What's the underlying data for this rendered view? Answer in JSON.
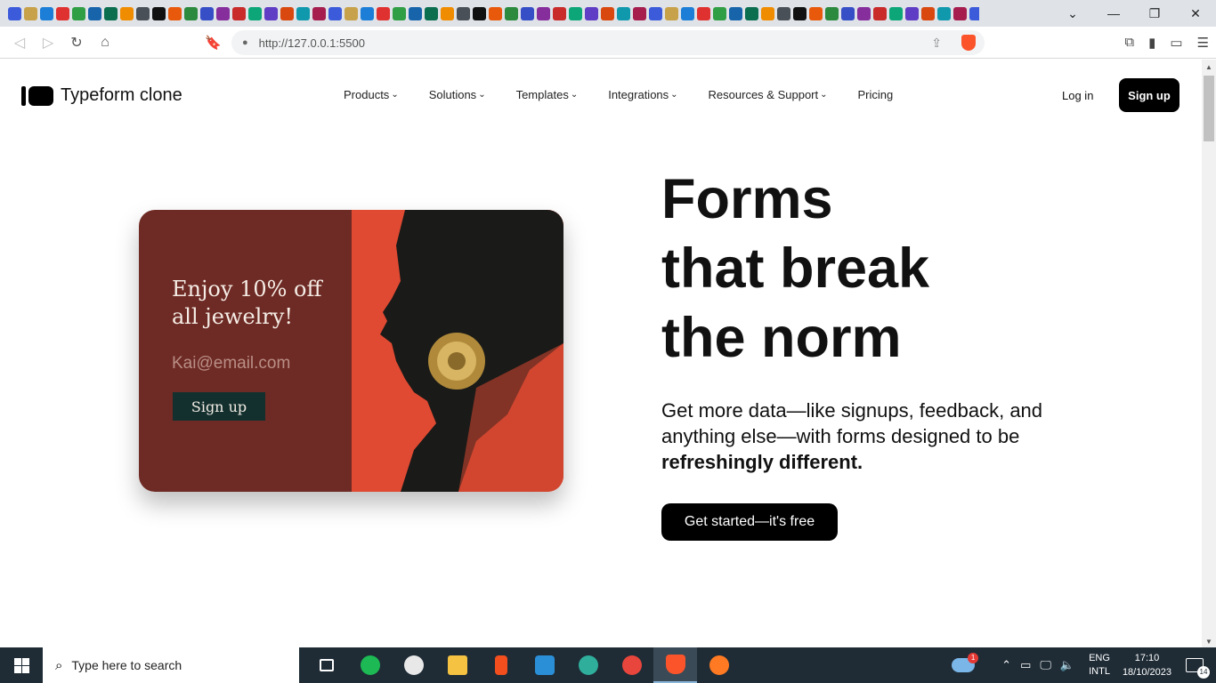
{
  "browser": {
    "url": "http://127.0.0.1:5500",
    "tab_close": "×",
    "new_tab": "+",
    "window_controls": [
      "⌄",
      "—",
      "❐",
      "✕"
    ]
  },
  "site": {
    "logo_text": "Typeform clone",
    "nav": [
      "Products",
      "Solutions",
      "Templates",
      "Integrations",
      "Resources & Support",
      "Pricing"
    ],
    "login": "Log in",
    "signup": "Sign up"
  },
  "card": {
    "title": "Enjoy 10% off all jewelry!",
    "email_placeholder": "Kai@email.com",
    "button": "Sign up"
  },
  "hero": {
    "title_lines": [
      "Forms",
      "that break",
      "the norm"
    ],
    "subtitle_plain": "Get more data—like signups, feedback, and anything else—with forms designed to be ",
    "subtitle_bold": "refreshingly different.",
    "cta": "Get started—it's free"
  },
  "taskbar": {
    "search_placeholder": "Type here to search",
    "cloud_badge": "1",
    "lang_1": "ENG",
    "lang_2": "INTL",
    "time": "17:10",
    "date": "18/10/2023",
    "notif_count": "14"
  },
  "colors": {
    "card_left": "#6e2a24",
    "card_right": "#e14a32",
    "card_button": "#14302e",
    "taskbar": "#1f2c36",
    "brave": "#fb542b"
  }
}
